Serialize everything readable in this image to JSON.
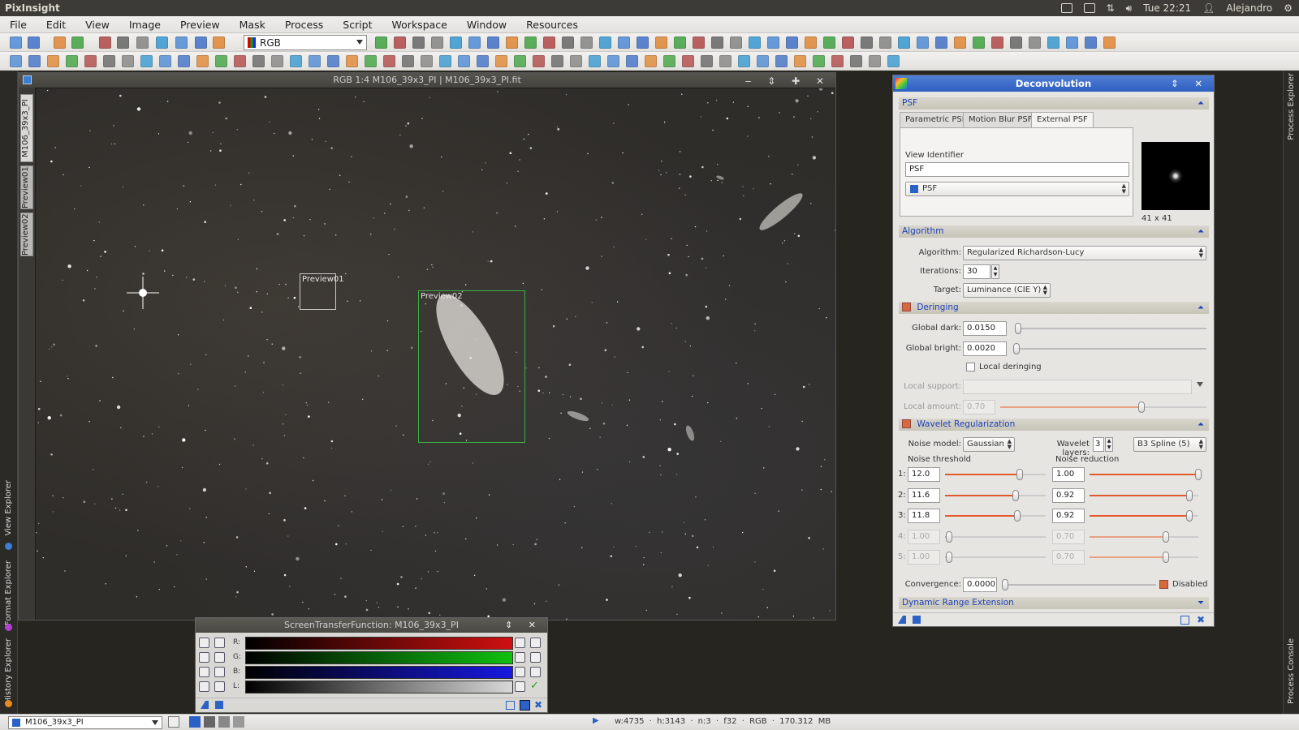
{
  "os_topbar": {
    "app_name": "PixInsight",
    "clock": "Tue 22:21",
    "user": "Alejandro"
  },
  "menu": [
    "File",
    "Edit",
    "View",
    "Image",
    "Preview",
    "Mask",
    "Process",
    "Script",
    "Workspace",
    "Window",
    "Resources"
  ],
  "toolbar": {
    "channel_select": "RGB"
  },
  "image_window": {
    "title": "RGB 1:4 M106_39x3_PI | M106_39x3_PI.fit",
    "tabs": [
      "M106_39x3_PI",
      "Preview01",
      "Preview02"
    ],
    "previews": [
      {
        "label": "Preview01",
        "color": "#c8c8c8"
      },
      {
        "label": "Preview02",
        "color": "#3cb043"
      }
    ]
  },
  "left_dock": [
    "View Explorer",
    "Format Explorer",
    "History Explorer"
  ],
  "right_dock": [
    "Process Explorer",
    "Process Console"
  ],
  "stf": {
    "title": "ScreenTransferFunction: M106_39x3_PI",
    "channels": [
      {
        "label": "R:",
        "color": "#d01010"
      },
      {
        "label": "G:",
        "color": "#10c010"
      },
      {
        "label": "B:",
        "color": "#1818e0"
      },
      {
        "label": "L:",
        "color": "#d8d8d8"
      }
    ]
  },
  "deconvolution": {
    "title": "Deconvolution",
    "psf": {
      "section": "PSF",
      "tabs": [
        "Parametric PSF",
        "Motion Blur PSF",
        "External PSF"
      ],
      "active_tab": "External PSF",
      "view_identifier_label": "View Identifier",
      "view_identifier_value": "PSF",
      "view_select": "PSF",
      "thumb_size": "41 x 41"
    },
    "algorithm": {
      "section": "Algorithm",
      "algorithm_label": "Algorithm:",
      "algorithm_value": "Regularized Richardson-Lucy",
      "iterations_label": "Iterations:",
      "iterations_value": "30",
      "target_label": "Target:",
      "target_value": "Luminance (CIE Y)"
    },
    "deringing": {
      "section": "Deringing",
      "enabled": true,
      "global_dark_label": "Global dark:",
      "global_dark_value": "0.0150",
      "global_bright_label": "Global bright:",
      "global_bright_value": "0.0020",
      "local_deringing_label": "Local deringing",
      "local_deringing_checked": false,
      "local_support_label": "Local support:",
      "local_support_value": "",
      "local_amount_label": "Local amount:",
      "local_amount_value": "0.70"
    },
    "wavelet": {
      "section": "Wavelet Regularization",
      "enabled": true,
      "noise_model_label": "Noise model:",
      "noise_model_value": "Gaussian",
      "wavelet_layers_label": "Wavelet layers:",
      "wavelet_layers_value": "3",
      "scaling_function": "B3 Spline (5)",
      "noise_threshold_header": "Noise threshold",
      "noise_reduction_header": "Noise reduction",
      "layers": [
        {
          "index": "1:",
          "threshold": "12.0",
          "reduction": "1.00",
          "enabled": true
        },
        {
          "index": "2:",
          "threshold": "11.6",
          "reduction": "0.92",
          "enabled": true
        },
        {
          "index": "3:",
          "threshold": "11.8",
          "reduction": "0.92",
          "enabled": true
        },
        {
          "index": "4:",
          "threshold": "1.00",
          "reduction": "0.70",
          "enabled": false
        },
        {
          "index": "5:",
          "threshold": "1.00",
          "reduction": "0.70",
          "enabled": false
        }
      ],
      "convergence_label": "Convergence:",
      "convergence_value": "0.0000",
      "disabled_label": "Disabled",
      "disabled_checked": true
    },
    "dynamic_range": {
      "section": "Dynamic Range Extension"
    }
  },
  "statusbar": {
    "view": "M106_39x3_PI",
    "info": "w:4735 · h:3143 · n:3 · f32 · RGB · 170.312 MB"
  }
}
